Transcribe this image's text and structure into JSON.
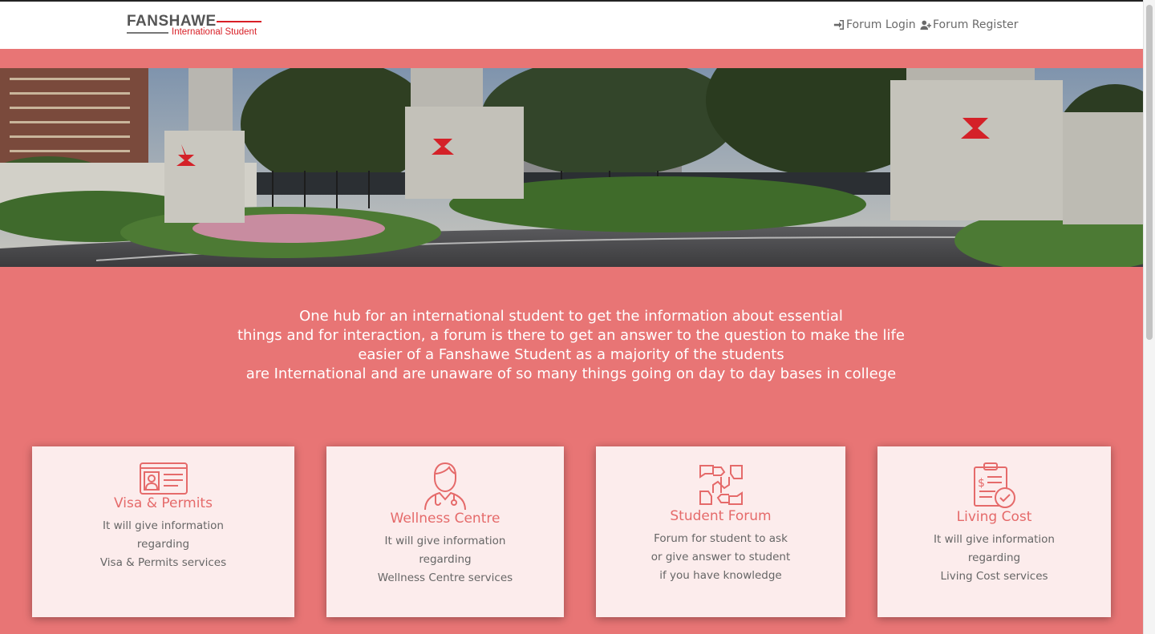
{
  "logo": {
    "main": "FANSHAWE",
    "sub": "International Student"
  },
  "nav": {
    "login": "Forum Login",
    "register": "Forum Register"
  },
  "intro": {
    "lines": [
      "One hub for an international student to get the information about essential",
      "things and for interaction, a forum is there to get an answer to the question to make the life",
      "easier of a Fanshawe Student as a majority of the students",
      "are International and are unaware of so many things going on day to day bases in college"
    ]
  },
  "cards": [
    {
      "title": "Visa & Permits",
      "icon": "id-card-icon",
      "lines": [
        "It will give information",
        "regarding",
        "Visa & Permits services"
      ]
    },
    {
      "title": "Wellness Centre",
      "icon": "doctor-icon",
      "lines": [
        "It will give information",
        "regarding",
        "Wellness Centre services"
      ]
    },
    {
      "title": "Student Forum",
      "icon": "hands-teamwork-icon",
      "lines": [
        "Forum for student to ask",
        "or give answer to student",
        "if you have knowledge"
      ]
    },
    {
      "title": "Living Cost",
      "icon": "clipboard-money-icon",
      "lines": [
        "It will give information",
        "regarding",
        "Living Cost services"
      ]
    }
  ],
  "colors": {
    "page_background": "#e87575",
    "card_background": "#fcecec",
    "accent": "#e56a6a",
    "brand_red": "#d81f26"
  }
}
